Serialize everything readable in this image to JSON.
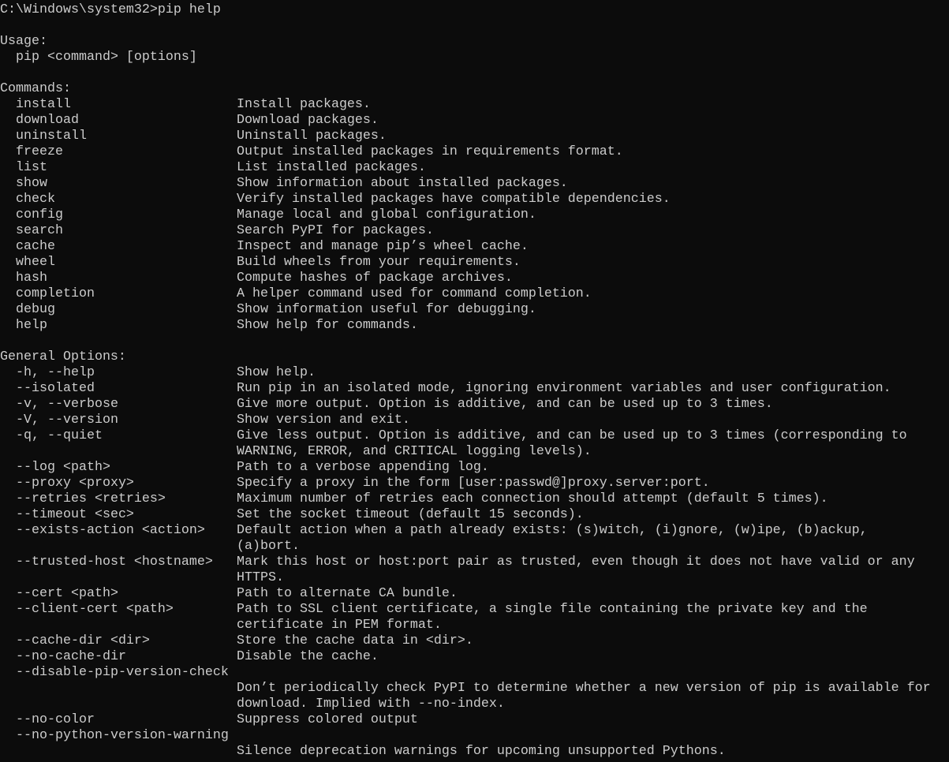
{
  "prompt": "C:\\Windows\\system32>pip help",
  "usage": {
    "heading": "Usage:",
    "line": "pip <command> [options]"
  },
  "commands": {
    "heading": "Commands:",
    "items": [
      {
        "name": "install",
        "desc": "Install packages."
      },
      {
        "name": "download",
        "desc": "Download packages."
      },
      {
        "name": "uninstall",
        "desc": "Uninstall packages."
      },
      {
        "name": "freeze",
        "desc": "Output installed packages in requirements format."
      },
      {
        "name": "list",
        "desc": "List installed packages."
      },
      {
        "name": "show",
        "desc": "Show information about installed packages."
      },
      {
        "name": "check",
        "desc": "Verify installed packages have compatible dependencies."
      },
      {
        "name": "config",
        "desc": "Manage local and global configuration."
      },
      {
        "name": "search",
        "desc": "Search PyPI for packages."
      },
      {
        "name": "cache",
        "desc": "Inspect and manage pip’s wheel cache."
      },
      {
        "name": "wheel",
        "desc": "Build wheels from your requirements."
      },
      {
        "name": "hash",
        "desc": "Compute hashes of package archives."
      },
      {
        "name": "completion",
        "desc": "A helper command used for command completion."
      },
      {
        "name": "debug",
        "desc": "Show information useful for debugging."
      },
      {
        "name": "help",
        "desc": "Show help for commands."
      }
    ]
  },
  "options": {
    "heading": "General Options:",
    "items": [
      {
        "flag": "-h, --help",
        "desc": [
          "Show help."
        ]
      },
      {
        "flag": "--isolated",
        "desc": [
          "Run pip in an isolated mode, ignoring environment variables and user configuration."
        ]
      },
      {
        "flag": "-v, --verbose",
        "desc": [
          "Give more output. Option is additive, and can be used up to 3 times."
        ]
      },
      {
        "flag": "-V, --version",
        "desc": [
          "Show version and exit."
        ]
      },
      {
        "flag": "-q, --quiet",
        "desc": [
          "Give less output. Option is additive, and can be used up to 3 times (corresponding to",
          "WARNING, ERROR, and CRITICAL logging levels)."
        ]
      },
      {
        "flag": "--log <path>",
        "desc": [
          "Path to a verbose appending log."
        ]
      },
      {
        "flag": "--proxy <proxy>",
        "desc": [
          "Specify a proxy in the form [user:passwd@]proxy.server:port."
        ]
      },
      {
        "flag": "--retries <retries>",
        "desc": [
          "Maximum number of retries each connection should attempt (default 5 times)."
        ]
      },
      {
        "flag": "--timeout <sec>",
        "desc": [
          "Set the socket timeout (default 15 seconds)."
        ]
      },
      {
        "flag": "--exists-action <action>",
        "desc": [
          "Default action when a path already exists: (s)witch, (i)gnore, (w)ipe, (b)ackup,",
          "(a)bort."
        ]
      },
      {
        "flag": "--trusted-host <hostname>",
        "desc": [
          "Mark this host or host:port pair as trusted, even though it does not have valid or any",
          "HTTPS."
        ]
      },
      {
        "flag": "--cert <path>",
        "desc": [
          "Path to alternate CA bundle."
        ]
      },
      {
        "flag": "--client-cert <path>",
        "desc": [
          "Path to SSL client certificate, a single file containing the private key and the",
          "certificate in PEM format."
        ]
      },
      {
        "flag": "--cache-dir <dir>",
        "desc": [
          "Store the cache data in <dir>."
        ]
      },
      {
        "flag": "--no-cache-dir",
        "desc": [
          "Disable the cache."
        ]
      },
      {
        "flag": "--disable-pip-version-check",
        "wrap": true,
        "desc": [
          "Don’t periodically check PyPI to determine whether a new version of pip is available for",
          "download. Implied with --no-index."
        ]
      },
      {
        "flag": "--no-color",
        "desc": [
          "Suppress colored output"
        ]
      },
      {
        "flag": "--no-python-version-warning",
        "wrap": true,
        "desc": [
          "Silence deprecation warnings for upcoming unsupported Pythons."
        ]
      }
    ]
  }
}
